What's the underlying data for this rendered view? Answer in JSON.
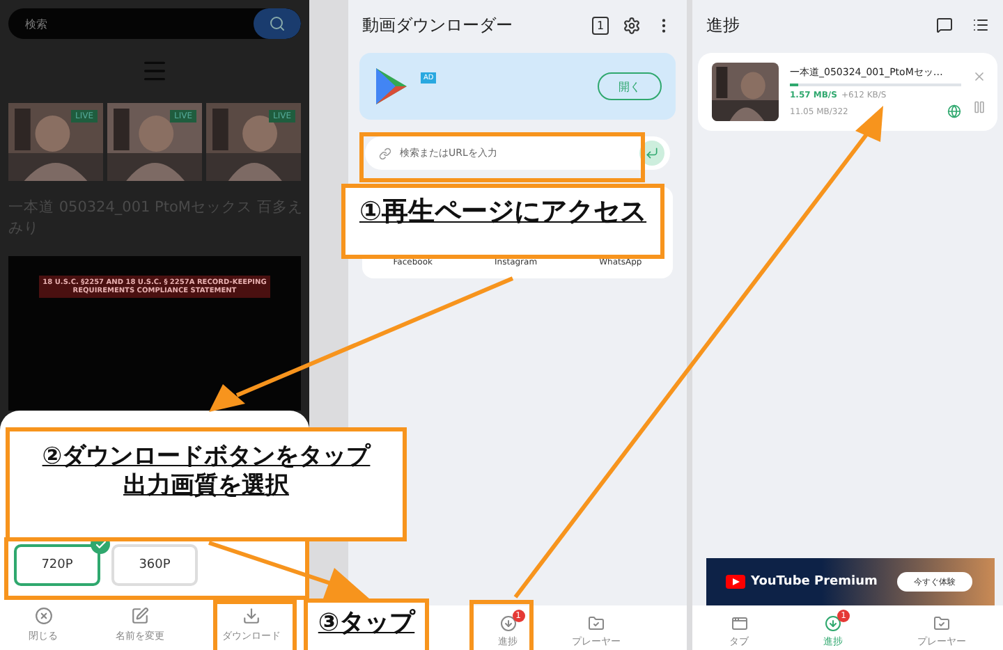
{
  "browser_page": {
    "search_placeholder": "検索",
    "thumbnails": [
      {
        "badge": "LIVE"
      },
      {
        "badge": "LIVE"
      },
      {
        "badge": "LIVE"
      }
    ],
    "video_title": "一本道 050324_001 PtoMセックス 百多えみり",
    "notice_heading": "18 U.S.C. §2257 AND 18 U.S.C. § 2257A RECORD-KEEPING REQUIREMENTS COMPLIANCE STATEMENT"
  },
  "quality_sheet": {
    "options": [
      {
        "label": "720P",
        "selected": true
      },
      {
        "label": "360P",
        "selected": false
      }
    ],
    "actions": [
      {
        "kind": "close",
        "label": "閉じる"
      },
      {
        "kind": "rename",
        "label": "名前を変更"
      },
      {
        "kind": "download",
        "label": "ダウンロード"
      }
    ]
  },
  "downloader": {
    "title": "動画ダウンローダー",
    "tab_count": "1",
    "ad": {
      "badge": "AD",
      "button": "開く"
    },
    "url_field": {
      "placeholder": "検索またはURLを入力"
    },
    "shortcuts": [
      "Facebook",
      "Instagram",
      "WhatsApp"
    ],
    "nav": [
      {
        "kind": "progress",
        "label": "進捗",
        "badge": "1",
        "selected": false
      },
      {
        "kind": "player",
        "label": "プレーヤー",
        "selected": false
      }
    ]
  },
  "progress": {
    "title": "進捗",
    "item": {
      "title": "一本道_050324_001_PtoMセッ…",
      "speed": "1.57 MB/S",
      "extra_speed": "+612 KB/S",
      "size": "11.05 MB/322",
      "level": 0.05
    },
    "ad": {
      "brand": "YouTube Premium",
      "button": "今すぐ体験"
    },
    "nav": [
      {
        "kind": "tab",
        "label": "タブ",
        "selected": false
      },
      {
        "kind": "progress",
        "label": "進捗",
        "badge": "1",
        "selected": true
      },
      {
        "kind": "player",
        "label": "プレーヤー",
        "selected": false
      }
    ]
  },
  "annotations": [
    {
      "lines": [
        "①再生ページにアクセス"
      ]
    },
    {
      "lines": [
        "②ダウンロードボタンをタップ",
        "出力画質を選択"
      ]
    },
    {
      "lines": [
        "③タップ"
      ]
    }
  ]
}
